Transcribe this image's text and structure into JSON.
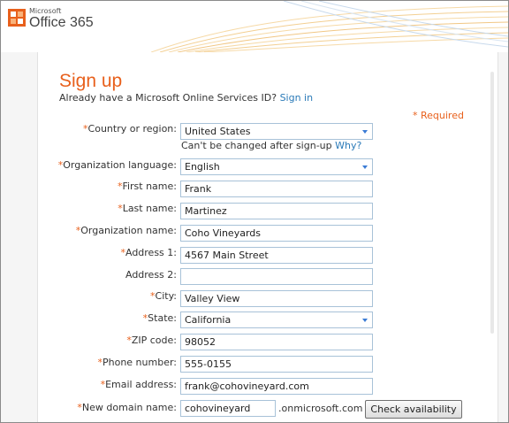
{
  "header": {
    "brand_small": "Microsoft",
    "brand": "Office 365"
  },
  "page": {
    "title": "Sign up",
    "prompt": "Already have a Microsoft Online Services ID?",
    "sign_in_link": "Sign in",
    "required_marker": "*",
    "required_text": "Required"
  },
  "form": {
    "country": {
      "label": "Country or region:",
      "value": "United States",
      "required": true
    },
    "country_note": "Can't be changed after sign-up",
    "country_why": "Why?",
    "language": {
      "label": "Organization language:",
      "value": "English",
      "required": true
    },
    "first_name": {
      "label": "First name:",
      "value": "Frank",
      "required": true
    },
    "last_name": {
      "label": "Last name:",
      "value": "Martinez",
      "required": true
    },
    "org_name": {
      "label": "Organization name:",
      "value": "Coho Vineyards",
      "required": true
    },
    "address1": {
      "label": "Address 1:",
      "value": "4567 Main Street",
      "required": true
    },
    "address2": {
      "label": "Address 2:",
      "value": "",
      "required": false
    },
    "city": {
      "label": "City:",
      "value": "Valley View",
      "required": true
    },
    "state": {
      "label": "State:",
      "value": "California",
      "required": true
    },
    "zip": {
      "label": "ZIP code:",
      "value": "98052",
      "required": true
    },
    "phone": {
      "label": "Phone number:",
      "value": "555-0155",
      "required": true
    },
    "email": {
      "label": "Email address:",
      "value": "frank@cohovineyard.com",
      "required": true
    },
    "domain": {
      "label": "New domain name:",
      "value": "cohovineyard",
      "suffix": ".onmicrosoft.com",
      "required": true
    },
    "check_button": "Check availability"
  },
  "colors": {
    "accent_orange": "#e8601c",
    "link_blue": "#2a7ab8",
    "input_border": "#a8c2d8"
  }
}
